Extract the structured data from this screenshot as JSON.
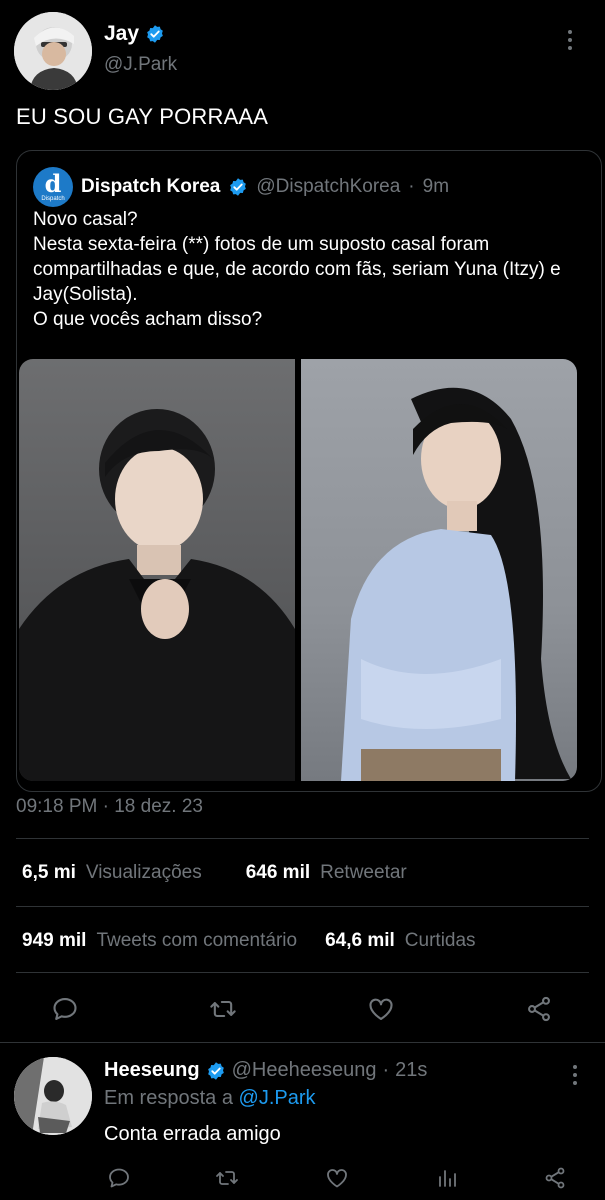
{
  "tweet": {
    "author_name": "Jay",
    "author_handle": "@J.Park",
    "text": "EU SOU GAY PORRAAA",
    "timestamp": "09:18 PM · 18 dez. 23"
  },
  "quote": {
    "author_name": "Dispatch Korea",
    "author_handle": "@DispatchKorea",
    "separator": "·",
    "time": "9m",
    "avatar_letter": "d",
    "avatar_caption": "Dispatch",
    "text": "Novo casal?\nNesta sexta-feira (**) fotos de um suposto casal foram compartilhadas e que, de acordo com fãs, seriam Yuna (Itzy) e Jay(Solista).\nO que vocês acham disso?"
  },
  "stats": {
    "views_count": "6,5 mi",
    "views_label": "Visualizações",
    "retweets_count": "646 mil",
    "retweets_label": "Retweetar",
    "quotes_count": "949 mil",
    "quotes_label": "Tweets com comentário",
    "likes_count": "64,6 mil",
    "likes_label": "Curtidas"
  },
  "reply": {
    "author_name": "Heeseung",
    "author_handle": "@Heeheeseung",
    "separator": "·",
    "time": "21s",
    "reply_prefix": "Em resposta a",
    "reply_mention": "@J.Park",
    "text": "Conta errada amigo"
  },
  "icons": {
    "verified": "verified-badge-icon",
    "more": "more-vertical-icon",
    "reply": "reply-icon",
    "retweet": "retweet-icon",
    "like": "heart-icon",
    "share": "share-icon",
    "analytics": "analytics-icon"
  },
  "colors": {
    "background": "#000000",
    "text": "#e7e9ea",
    "muted": "#71767b",
    "accent": "#1d9bf0",
    "divider": "#2f3336"
  }
}
